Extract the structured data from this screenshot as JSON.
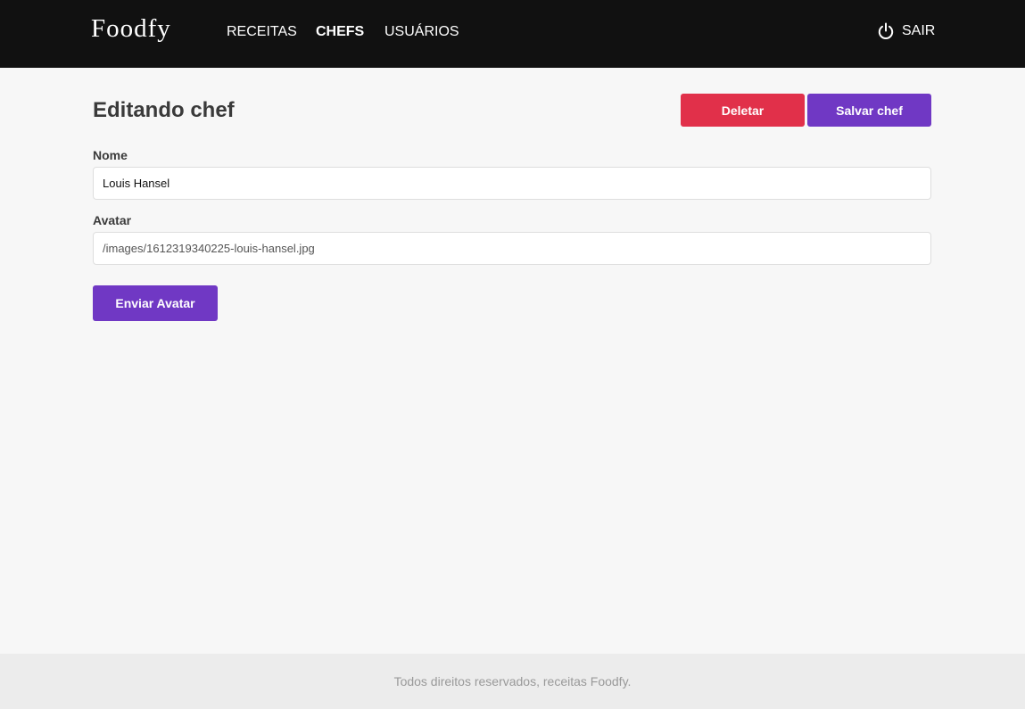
{
  "header": {
    "logo": "Foodfy",
    "nav": [
      {
        "label": "RECEITAS",
        "active": false
      },
      {
        "label": "CHEFS",
        "active": true
      },
      {
        "label": "USUÁRIOS",
        "active": false
      }
    ],
    "logout": {
      "label": "SAIR",
      "icon": "power-icon"
    }
  },
  "main": {
    "title": "Editando chef",
    "actions": {
      "delete_label": "Deletar",
      "save_label": "Salvar chef"
    },
    "form": {
      "name_label": "Nome",
      "name_value": "Louis Hansel",
      "avatar_label": "Avatar",
      "avatar_value": "/images/1612319340225-louis-hansel.jpg",
      "upload_label": "Enviar Avatar"
    }
  },
  "footer": {
    "text": "Todos direitos reservados, receitas Foodfy."
  },
  "colors": {
    "header_bg": "#111111",
    "danger": "#e1304a",
    "primary": "#7038c4",
    "page_bg": "#f7f7f7",
    "footer_bg": "#ececec"
  }
}
